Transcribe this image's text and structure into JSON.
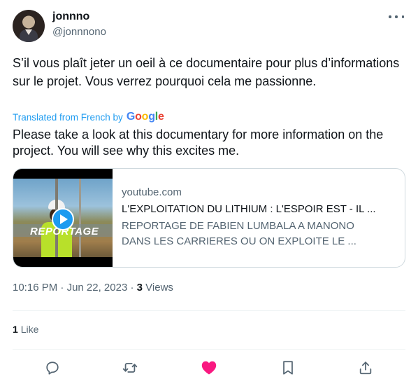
{
  "author": {
    "display_name": "jonnno",
    "handle": "@jonnnono"
  },
  "tweet": {
    "text": "S’il vous plaît jeter un oeil à ce documentaire pour plus d’informations sur le projet. Vous verrez pourquoi cela me passionne.",
    "translated_from": "Translated from French by",
    "translator_brand": [
      "G",
      "o",
      "o",
      "g",
      "l",
      "e"
    ],
    "translation": "Please take a look at this documentary for more information on the project. You will see why this excites me."
  },
  "link_card": {
    "domain": "youtube.com",
    "title": "L'EXPLOITATION DU LITHIUM : L'ESPOIR EST - IL ...",
    "description_line1": "REPORTAGE DE FABIEN LUMBALA A MANONO",
    "description_line2": "DANS LES CARRIERES OU ON EXPLOITE LE ...",
    "thumbnail_overlay_text": "REPORTAGE"
  },
  "meta": {
    "time": "10:16 PM",
    "separator": "·",
    "date": "Jun 22, 2023",
    "views_count": "3",
    "views_label": "Views"
  },
  "engagement": {
    "likes_count": "1",
    "likes_label": "Like"
  },
  "icons": {
    "more": "more-horizontal-icon",
    "reply": "reply-icon",
    "retweet": "retweet-icon",
    "like": "heart-filled-icon",
    "bookmark": "bookmark-icon",
    "share": "share-icon",
    "play": "play-icon"
  },
  "colors": {
    "accent": "#1d9bf0",
    "liked": "#f91880",
    "secondary_text": "#536471",
    "border": "#cfd9de"
  }
}
